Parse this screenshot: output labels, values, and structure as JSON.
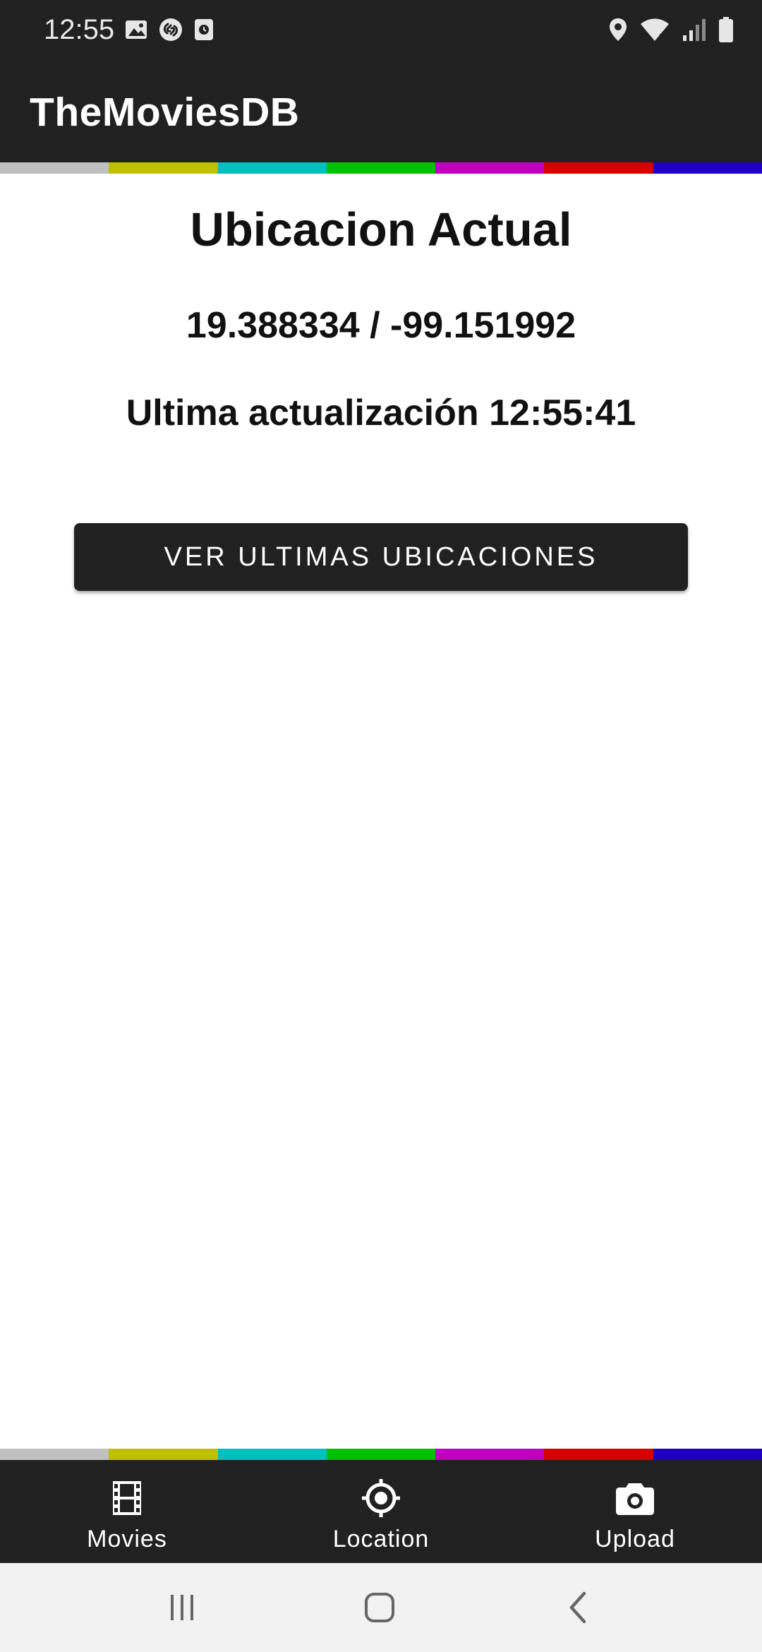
{
  "status_bar": {
    "time": "12:55",
    "left_icons": [
      "image-icon",
      "shazam-icon",
      "clock-square-icon"
    ],
    "right_icons": [
      "location-pin-icon",
      "wifi-icon",
      "signal-icon",
      "battery-icon"
    ]
  },
  "app_bar": {
    "title": "TheMoviesDB"
  },
  "stripe_colors": [
    "#c0c0c0",
    "#bfc000",
    "#00c0c0",
    "#00c000",
    "#c000c0",
    "#d60000",
    "#2000c0"
  ],
  "location": {
    "heading": "Ubicacion Actual",
    "coordinates": "19.388334 / -99.151992",
    "last_update": "Ultima actualización 12:55:41"
  },
  "button": {
    "label": "VER ULTIMAS UBICACIONES"
  },
  "bottom_nav": {
    "items": [
      {
        "label": "Movies",
        "icon": "film-icon"
      },
      {
        "label": "Location",
        "icon": "crosshair-icon"
      },
      {
        "label": "Upload",
        "icon": "camera-icon"
      }
    ]
  },
  "system_nav": {
    "buttons": [
      "recents-icon",
      "home-icon",
      "back-icon"
    ]
  },
  "colors": {
    "bar_background": "#212121",
    "content_background": "#ffffff",
    "system_nav_background": "#f2f2f2"
  }
}
